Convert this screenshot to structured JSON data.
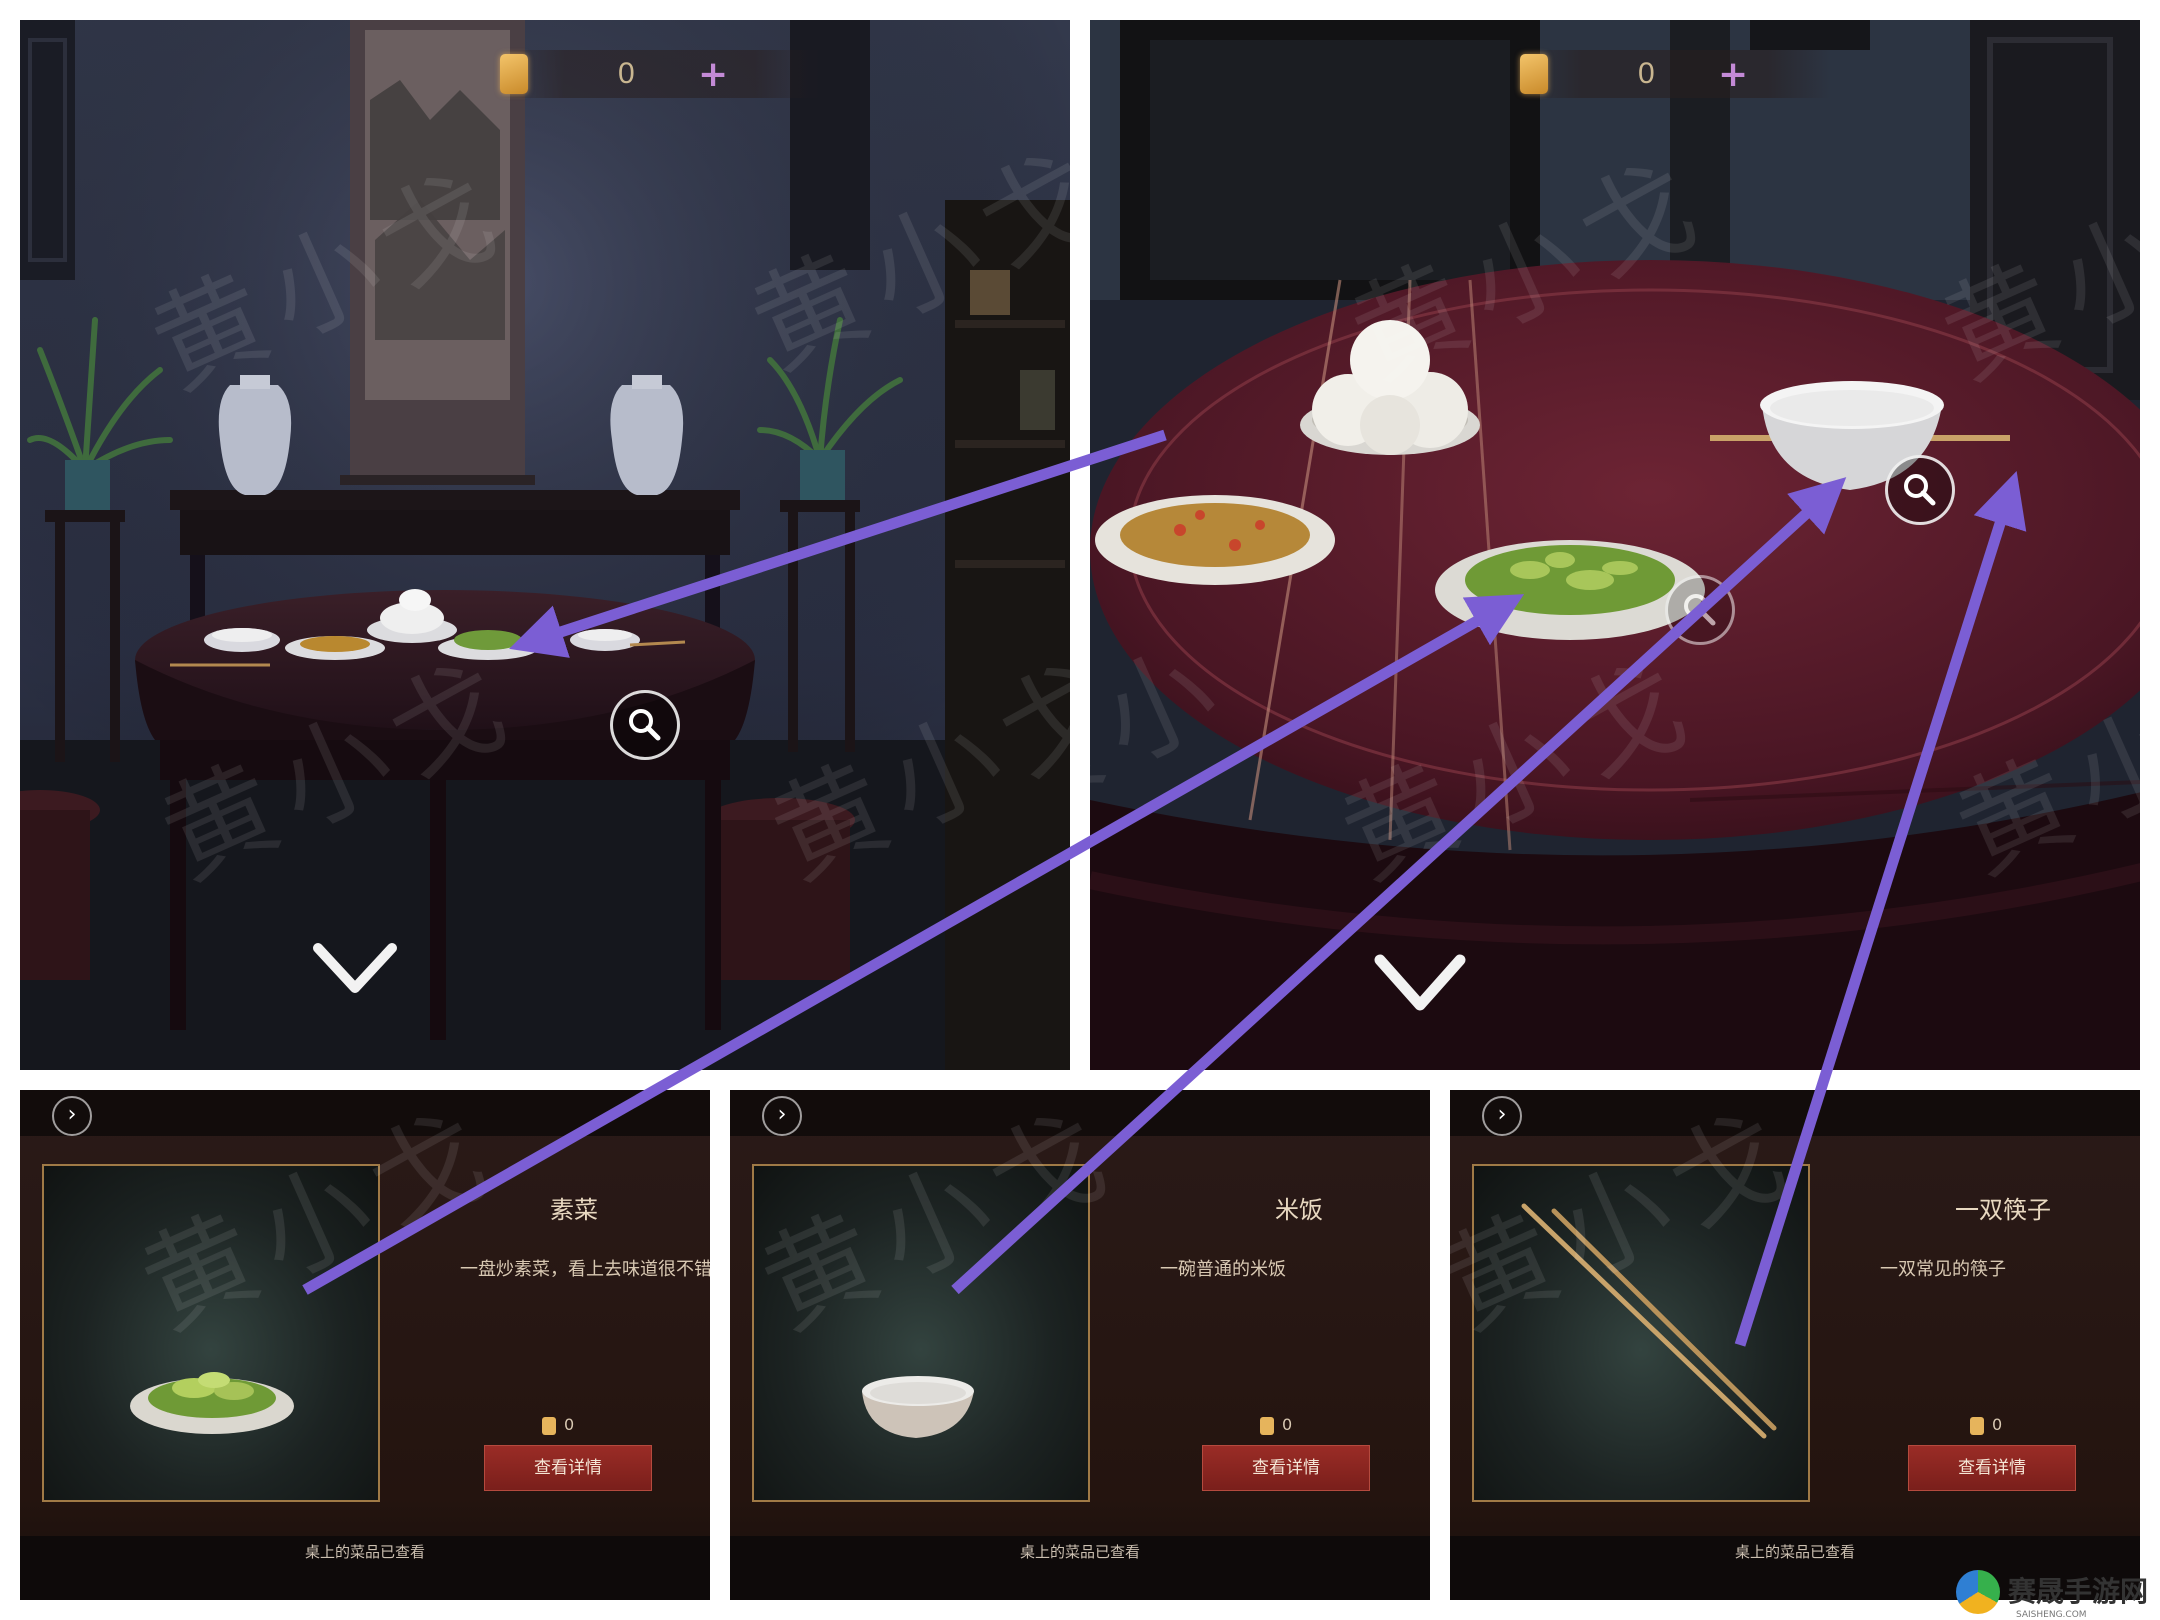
{
  "colors": {
    "arrow": "#7b5ed4",
    "accent_plus": "#c38ad6",
    "button_red": "#8a241f",
    "frame_gold": "#a07a46"
  },
  "top_left_panel": {
    "hud": {
      "coin_icon": "coin-card-icon",
      "count": "0",
      "plus": "+"
    },
    "watermarks": [
      "黄小戈",
      "黄小戈",
      "黄小戈",
      "黄小戈"
    ],
    "icons": [
      "magnifier-icon",
      "chevron-down-icon"
    ]
  },
  "top_right_panel": {
    "hud": {
      "coin_icon": "coin-card-icon",
      "count": "0",
      "plus": "+"
    },
    "watermarks": [
      "黄小戈",
      "黄小戈",
      "黄小",
      "黄小",
      "黄小戈"
    ],
    "icons": [
      "magnifier-icon",
      "magnifier-icon",
      "chevron-down-icon"
    ]
  },
  "item_panels": [
    {
      "title": "素菜",
      "description": "一盘炒素菜，看上去味道很不错",
      "cost": "0",
      "button": "查看详情",
      "hint": "桌上的菜品已查看",
      "watermark": "黄小戈"
    },
    {
      "title": "米饭",
      "description": "一碗普通的米饭",
      "cost": "0",
      "button": "查看详情",
      "hint": "桌上的菜品已查看",
      "watermark": "黄小戈"
    },
    {
      "title": "一双筷子",
      "description": "一双常见的筷子",
      "cost": "0",
      "button": "查看详情",
      "hint": "桌上的菜品已查看",
      "watermark": "黄小戈"
    }
  ],
  "site": {
    "name": "赛晟手游网",
    "sub": "SAISHENG.COM"
  }
}
